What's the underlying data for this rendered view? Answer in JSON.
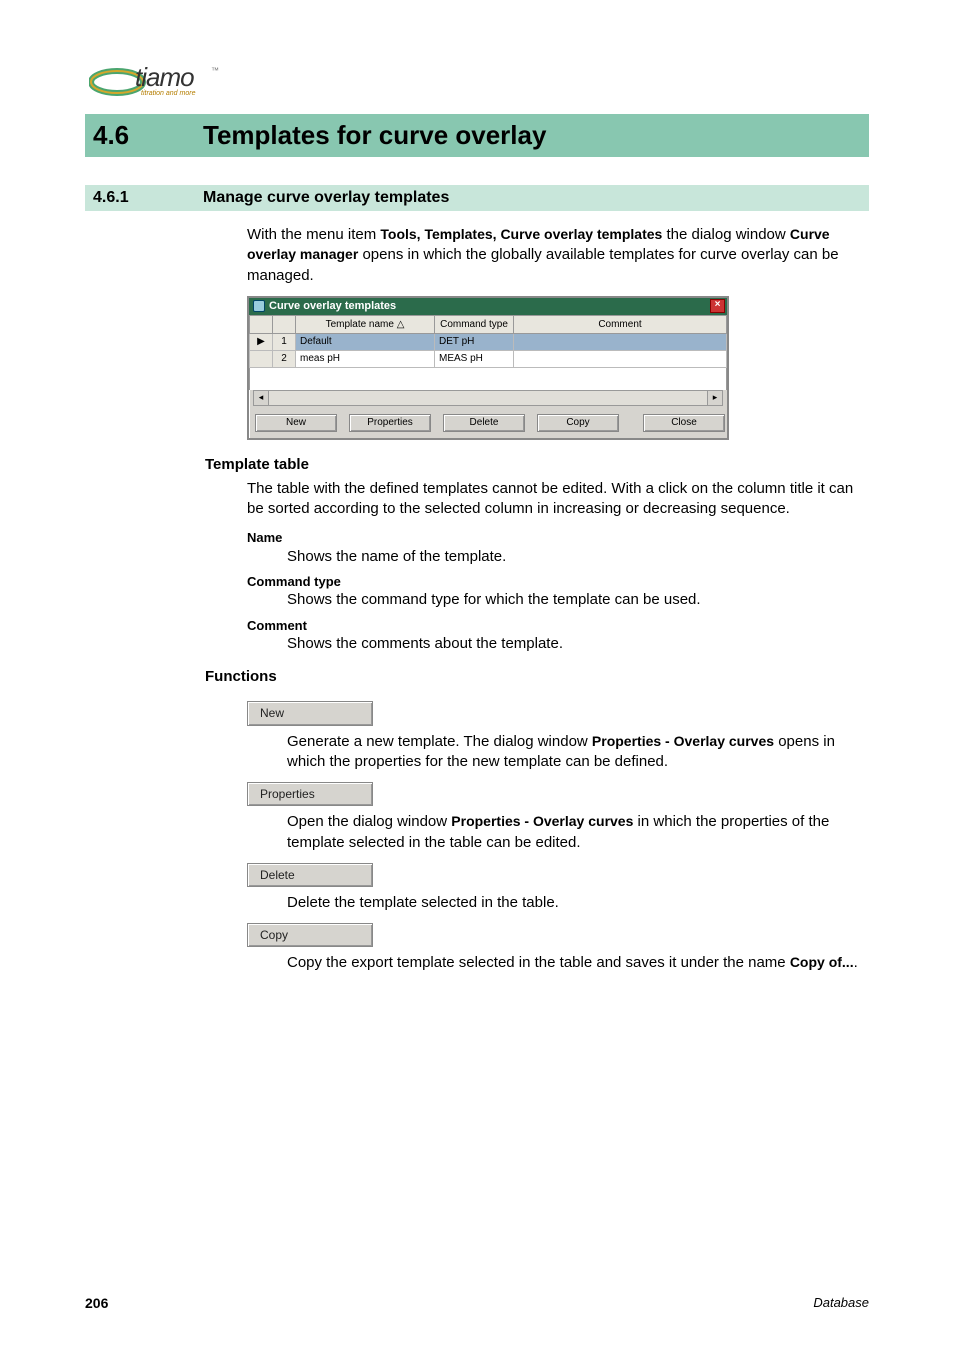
{
  "logo": {
    "brand": "tiamo",
    "tm": "™",
    "sub": "titration and more"
  },
  "h1": {
    "num": "4.6",
    "title": "Templates for curve overlay"
  },
  "h2": {
    "num": "4.6.1",
    "title": "Manage curve overlay templates"
  },
  "intro": {
    "p1a": "With the menu item ",
    "p1b": "Tools, Templates, Curve overlay templates",
    "p1c": " the dialog window ",
    "p1d": "Curve overlay manager",
    "p1e": " opens in which the globally available templates for curve overlay can be managed."
  },
  "win": {
    "title": "Curve overlay templates",
    "close": "×",
    "headers": {
      "name": "Template name  △",
      "cmd": "Command type",
      "comment": "Comment"
    },
    "rows": [
      {
        "ptr": "▶",
        "idx": "1",
        "name": "Default",
        "cmd": "DET pH",
        "comment": "",
        "selected": true
      },
      {
        "ptr": "",
        "idx": "2",
        "name": "meas pH",
        "cmd": "MEAS pH",
        "comment": "",
        "selected": false
      }
    ],
    "scroll": {
      "left": "◂",
      "right": "▸"
    },
    "buttons": {
      "new": "New",
      "props": "Properties",
      "delete": "Delete",
      "copy": "Copy",
      "close": "Close"
    }
  },
  "templateTable": {
    "heading": "Template table",
    "para": "The table with the defined templates cannot be edited. With a click on the column title it can be sorted according to the selected column in increasing or decreasing sequence.",
    "name_t": "Name",
    "name_d": "Shows the name of the template.",
    "cmd_t": "Command type",
    "cmd_d": "Shows the command type for which the template can be used.",
    "com_t": "Comment",
    "com_d": "Shows the comments about the template."
  },
  "functions": {
    "heading": "Functions",
    "new": {
      "label": "New",
      "d1": "Generate a new template. The dialog window ",
      "d2": "Properties - Overlay curves",
      "d3": " opens in which the properties for the new template can be defined."
    },
    "props": {
      "label": "Properties",
      "d1": "Open the dialog window ",
      "d2": "Properties - Overlay curves",
      "d3": " in which the properties of the template selected in the table can be edited."
    },
    "del": {
      "label": "Delete",
      "d1": "Delete the template selected in the table."
    },
    "copy": {
      "label": "Copy",
      "d1": "Copy the export template selected in the table and saves it under the name ",
      "d2": "Copy of...",
      "d3": "."
    }
  },
  "footer": {
    "page": "206",
    "source": "Database"
  }
}
